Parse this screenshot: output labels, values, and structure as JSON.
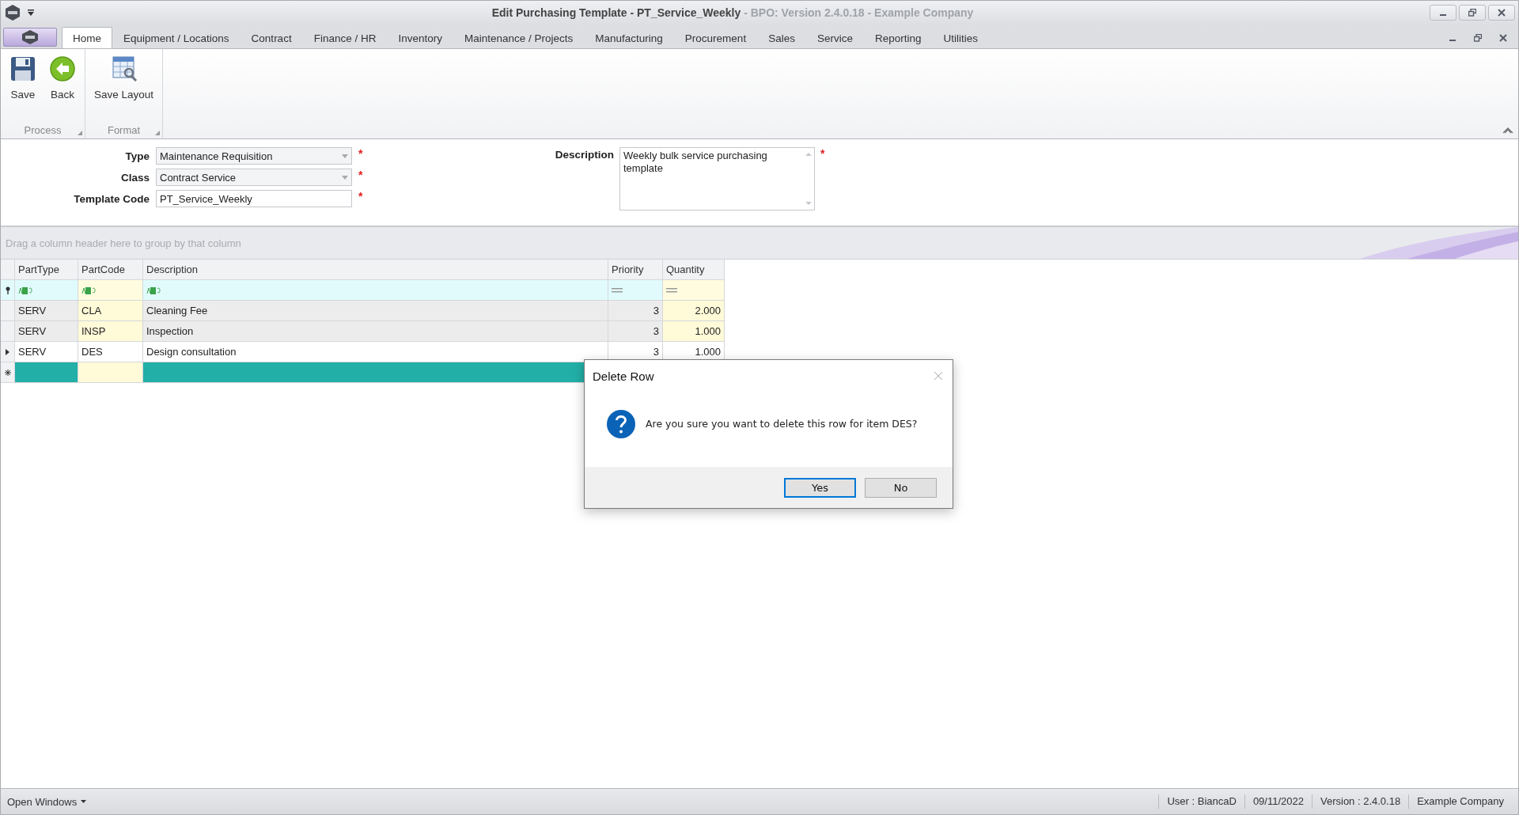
{
  "window": {
    "title": "Edit Purchasing Template - PT_Service_Weekly",
    "subtitle": "- BPO: Version 2.4.0.18 - Example Company"
  },
  "ribbon": {
    "tabs": [
      {
        "label": "Home",
        "selected": true
      },
      {
        "label": "Equipment / Locations",
        "selected": false
      },
      {
        "label": "Contract",
        "selected": false
      },
      {
        "label": "Finance / HR",
        "selected": false
      },
      {
        "label": "Inventory",
        "selected": false
      },
      {
        "label": "Maintenance / Projects",
        "selected": false
      },
      {
        "label": "Manufacturing",
        "selected": false
      },
      {
        "label": "Procurement",
        "selected": false
      },
      {
        "label": "Sales",
        "selected": false
      },
      {
        "label": "Service",
        "selected": false
      },
      {
        "label": "Reporting",
        "selected": false
      },
      {
        "label": "Utilities",
        "selected": false
      }
    ],
    "groups": [
      {
        "label": "Process",
        "buttons": [
          {
            "label": "Save",
            "kind": "save"
          },
          {
            "label": "Back",
            "kind": "back"
          }
        ]
      },
      {
        "label": "Format",
        "buttons": [
          {
            "label": "Save Layout",
            "kind": "layout"
          }
        ]
      }
    ]
  },
  "form": {
    "fields": [
      {
        "label": "Type",
        "value": "Maintenance Requisition",
        "kind": "dropdown",
        "required_mark": "*"
      },
      {
        "label": "Class",
        "value": "Contract Service",
        "kind": "dropdown",
        "required_mark": "*"
      },
      {
        "label": "Template Code",
        "value": "PT_Service_Weekly",
        "kind": "text",
        "required_mark": "*"
      }
    ],
    "description": {
      "label": "Description",
      "value": "Weekly bulk service purchasing template",
      "required_mark": "*"
    }
  },
  "grid": {
    "group_panel": "Drag a column header here to group by that column",
    "columns": [
      {
        "label": "PartType",
        "kind": "text",
        "editable": false
      },
      {
        "label": "PartCode",
        "kind": "text",
        "editable": true
      },
      {
        "label": "Description",
        "kind": "text",
        "editable": false
      },
      {
        "label": "Priority",
        "kind": "number",
        "editable": false
      },
      {
        "label": "Quantity",
        "kind": "number",
        "editable": true
      }
    ],
    "rows": [
      {
        "cells": [
          "SERV",
          "CLA",
          "Cleaning Fee",
          "3",
          "2.000"
        ],
        "selected": false
      },
      {
        "cells": [
          "SERV",
          "INSP",
          "Inspection",
          "3",
          "1.000"
        ],
        "selected": false
      },
      {
        "cells": [
          "SERV",
          "DES",
          "Design consultation",
          "3",
          "1.000"
        ],
        "selected": true
      }
    ]
  },
  "dialog": {
    "title": "Delete Row",
    "message": "Are you sure you want to delete this row for item DES?",
    "buttons": [
      {
        "label": "Yes",
        "default": true
      },
      {
        "label": "No",
        "default": false
      }
    ]
  },
  "status_bar": {
    "open_windows": "Open Windows",
    "items": [
      "User : BiancaD",
      "09/11/2022",
      "Version : 2.4.0.18",
      "Example Company"
    ]
  }
}
